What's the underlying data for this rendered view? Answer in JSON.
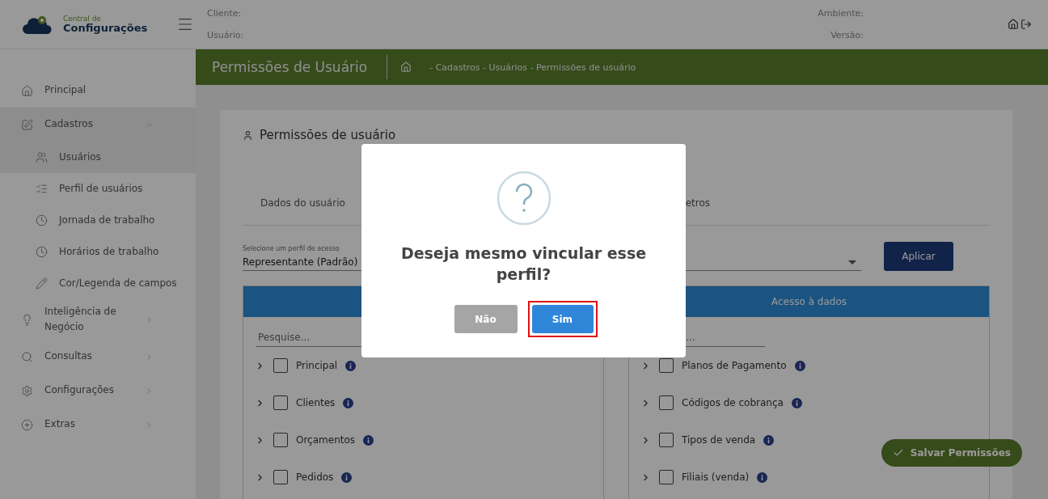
{
  "header": {
    "logo_small": "Central de",
    "logo_large": "Configurações",
    "client_label": "Cliente:",
    "user_label": "Usuário:",
    "environment_label": "Ambiente:",
    "version_label": "Versão:"
  },
  "sidebar": {
    "items": [
      {
        "label": "Principal",
        "expanded": false
      },
      {
        "label": "Cadastros",
        "expanded": true,
        "children": [
          {
            "label": "Usuários",
            "selected": true
          },
          {
            "label": "Perfil de usuários",
            "selected": false
          },
          {
            "label": "Jornada de trabalho",
            "selected": false
          },
          {
            "label": "Horários de trabalho",
            "selected": false
          },
          {
            "label": "Cor/Legenda de campos",
            "selected": false
          }
        ]
      },
      {
        "label": "Inteligência de Negócio",
        "expanded": false
      },
      {
        "label": "Consultas",
        "expanded": false
      },
      {
        "label": "Configurações",
        "expanded": false
      },
      {
        "label": "Extras",
        "expanded": false
      }
    ]
  },
  "page_bar": {
    "title": "Permissões de Usuário",
    "breadcrumb": "- Cadastros - Usuários - Permissões de usuário"
  },
  "card": {
    "title": "Permissões de usuário",
    "tabs": [
      {
        "label": "Dados do usuário",
        "selected": false
      },
      {
        "label": "etros",
        "selected": false
      }
    ],
    "profile_select": {
      "label": "Selecione um perfil de acesso",
      "value": "Representante (Padrão)"
    },
    "apply_button": "Aplicar",
    "panels": [
      {
        "search_placeholder": "Pesquise...",
        "items": [
          {
            "label": "Principal",
            "checked": false,
            "expanded": false
          },
          {
            "label": "Clientes",
            "checked": false,
            "expanded": false
          },
          {
            "label": "Orçamentos",
            "checked": false,
            "expanded": false
          },
          {
            "label": "Pedidos",
            "checked": false,
            "expanded": false
          }
        ]
      },
      {
        "header": "Acesso à dados",
        "search_placeholder": "...",
        "items": [
          {
            "label": "Planos de Pagamento",
            "checked": false,
            "expanded": false
          },
          {
            "label": "Códigos de cobrança",
            "checked": false,
            "expanded": false
          },
          {
            "label": "Tipos de venda",
            "checked": false,
            "expanded": false
          },
          {
            "label": "Filiais (venda)",
            "checked": false,
            "expanded": false
          }
        ]
      }
    ]
  },
  "save_button": "Salvar Permissões",
  "dialog": {
    "title": "Deseja mesmo vincular esse perfil?",
    "buttons": [
      {
        "label": "Não",
        "kind": "cancel",
        "highlighted": false
      },
      {
        "label": "Sim",
        "kind": "confirm",
        "highlighted": true
      }
    ]
  }
}
